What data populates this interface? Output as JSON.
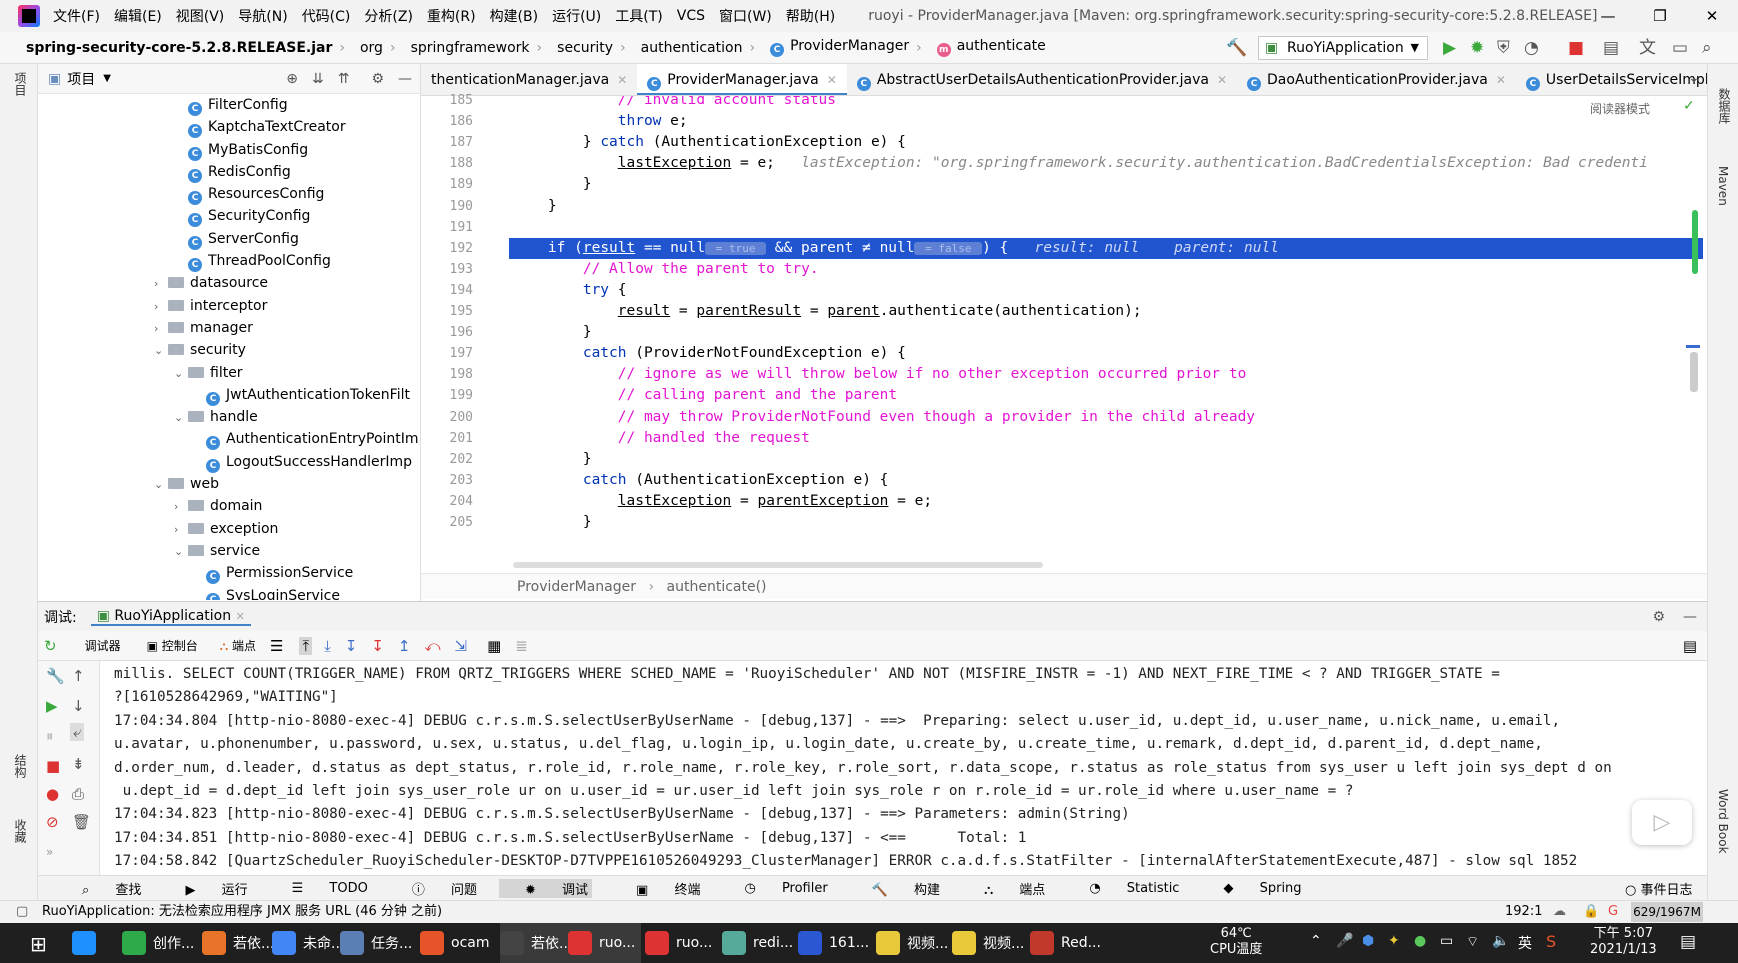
{
  "menu": [
    "文件(F)",
    "编辑(E)",
    "视图(V)",
    "导航(N)",
    "代码(C)",
    "分析(Z)",
    "重构(R)",
    "构建(B)",
    "运行(U)",
    "工具(T)",
    "VCS",
    "窗口(W)",
    "帮助(H)"
  ],
  "window_title": "ruoyi - ProviderManager.java [Maven: org.springframework.security:spring-security-core:5.2.8.RELEASE]",
  "breadcrumb": {
    "jar": "spring-security-core-5.2.8.RELEASE.jar",
    "parts": [
      "org",
      "springframework",
      "security",
      "authentication"
    ],
    "cls": "ProviderManager",
    "method": "authenticate"
  },
  "run_config": "RuoYiApplication",
  "project": {
    "title": "项目",
    "items": [
      {
        "label": "FilterConfig",
        "type": "class",
        "indent": 3
      },
      {
        "label": "KaptchaTextCreator",
        "type": "class",
        "indent": 3
      },
      {
        "label": "MyBatisConfig",
        "type": "class",
        "indent": 3
      },
      {
        "label": "RedisConfig",
        "type": "class",
        "indent": 3
      },
      {
        "label": "ResourcesConfig",
        "type": "class",
        "indent": 3
      },
      {
        "label": "SecurityConfig",
        "type": "class",
        "indent": 3
      },
      {
        "label": "ServerConfig",
        "type": "class",
        "indent": 3
      },
      {
        "label": "ThreadPoolConfig",
        "type": "class",
        "indent": 3
      },
      {
        "label": "datasource",
        "type": "folder",
        "indent": 2,
        "arrow": "›"
      },
      {
        "label": "interceptor",
        "type": "folder",
        "indent": 2,
        "arrow": "›"
      },
      {
        "label": "manager",
        "type": "folder",
        "indent": 2,
        "arrow": "›"
      },
      {
        "label": "security",
        "type": "folder",
        "indent": 2,
        "arrow": "⌄"
      },
      {
        "label": "filter",
        "type": "folder",
        "indent": 3,
        "arrow": "⌄"
      },
      {
        "label": "JwtAuthenticationTokenFilt",
        "type": "class",
        "indent": 4
      },
      {
        "label": "handle",
        "type": "folder",
        "indent": 3,
        "arrow": "⌄"
      },
      {
        "label": "AuthenticationEntryPointIm",
        "type": "class",
        "indent": 4
      },
      {
        "label": "LogoutSuccessHandlerImp",
        "type": "class",
        "indent": 4
      },
      {
        "label": "web",
        "type": "folder",
        "indent": 2,
        "arrow": "⌄"
      },
      {
        "label": "domain",
        "type": "folder",
        "indent": 3,
        "arrow": "›"
      },
      {
        "label": "exception",
        "type": "folder",
        "indent": 3,
        "arrow": "›"
      },
      {
        "label": "service",
        "type": "folder",
        "indent": 3,
        "arrow": "⌄"
      },
      {
        "label": "PermissionService",
        "type": "class",
        "indent": 4
      },
      {
        "label": "SysLoginService",
        "type": "class",
        "indent": 4
      }
    ]
  },
  "tabs": [
    {
      "label": "thenticationManager.java",
      "active": false
    },
    {
      "label": "ProviderManager.java",
      "active": true
    },
    {
      "label": "AbstractUserDetailsAuthenticationProvider.java",
      "active": false
    },
    {
      "label": "DaoAuthenticationProvider.java",
      "active": false
    },
    {
      "label": "UserDetailsServiceImpl.java",
      "active": false
    }
  ],
  "reader_mode": "阅读器模式",
  "code_lines": [
    {
      "n": "185",
      "html": "            <span class='cm'>// invalid account status</span>"
    },
    {
      "n": "186",
      "html": "            <span class='kw'>throw</span> e;"
    },
    {
      "n": "187",
      "html": "        } <span class='kw'>catch</span> (AuthenticationException e) {"
    },
    {
      "n": "188",
      "html": "            <span class='var'>lastException</span> = e;  <span class='hint'> lastException: \"org.springframework.security.authentication.BadCredentialsException: Bad credenti</span>"
    },
    {
      "n": "189",
      "html": "        }"
    },
    {
      "n": "190",
      "html": "    }"
    },
    {
      "n": "191",
      "html": ""
    },
    {
      "n": "192",
      "html": "    <span class='kw'>if</span> (<span class='var'>result</span> == null<span class='pill'> = true </span> &amp;&amp; parent ≠ null<span class='pill'> = false </span>) {  <span class='hint' style='color:#cfd8f5'> result: null    parent: null</span>",
      "hl": true
    },
    {
      "n": "193",
      "html": "        <span class='cm'>// Allow the parent to try.</span>"
    },
    {
      "n": "194",
      "html": "        <span class='kw'>try</span> {"
    },
    {
      "n": "195",
      "html": "            <span class='var'>result</span> = <span class='var'>parentResult</span> = <span class='var'>parent</span>.authenticate(authentication);"
    },
    {
      "n": "196",
      "html": "        }"
    },
    {
      "n": "197",
      "html": "        <span class='kw'>catch</span> (ProviderNotFoundException e) {"
    },
    {
      "n": "198",
      "html": "            <span class='cm'>// ignore as we will throw below if no other exception occurred prior to</span>"
    },
    {
      "n": "199",
      "html": "            <span class='cm'>// calling parent and the parent</span>"
    },
    {
      "n": "200",
      "html": "            <span class='cm'>// may throw ProviderNotFound even though a provider in the child already</span>"
    },
    {
      "n": "201",
      "html": "            <span class='cm'>// handled the request</span>"
    },
    {
      "n": "202",
      "html": "        }"
    },
    {
      "n": "203",
      "html": "        <span class='kw'>catch</span> (AuthenticationException e) {"
    },
    {
      "n": "204",
      "html": "            <span class='var'>lastException</span> = <span class='var'>parentException</span> = e;"
    },
    {
      "n": "205",
      "html": "        }"
    }
  ],
  "code_crumb": {
    "cls": "ProviderManager",
    "method": "authenticate()"
  },
  "debug": {
    "label": "调试:",
    "app": "RuoYiApplication",
    "tools": {
      "debugger": "调试器",
      "console": "控制台",
      "breakpoints": "端点"
    }
  },
  "console_lines": [
    "millis. SELECT COUNT(TRIGGER_NAME) FROM QRTZ_TRIGGERS WHERE SCHED_NAME = 'RuoyiScheduler' AND NOT (MISFIRE_INSTR = -1) AND NEXT_FIRE_TIME < ? AND TRIGGER_STATE =",
    "?[1610528642969,\"WAITING\"]",
    "17:04:34.804 [http-nio-8080-exec-4] DEBUG c.r.s.m.S.selectUserByUserName - [debug,137] - ==>  Preparing: select u.user_id, u.dept_id, u.user_name, u.nick_name, u.email,",
    "u.avatar, u.phonenumber, u.password, u.sex, u.status, u.del_flag, u.login_ip, u.login_date, u.create_by, u.create_time, u.remark, d.dept_id, d.parent_id, d.dept_name,",
    "d.order_num, d.leader, d.status as dept_status, r.role_id, r.role_name, r.role_key, r.role_sort, r.data_scope, r.status as role_status from sys_user u left join sys_dept d on",
    " u.dept_id = d.dept_id left join sys_user_role ur on u.user_id = ur.user_id left join sys_role r on r.role_id = ur.role_id where u.user_name = ?",
    "17:04:34.823 [http-nio-8080-exec-4] DEBUG c.r.s.m.S.selectUserByUserName - [debug,137] - ==> Parameters: admin(String)",
    "17:04:34.851 [http-nio-8080-exec-4] DEBUG c.r.s.m.S.selectUserByUserName - [debug,137] - <==      Total: 1",
    "17:04:58.842 [QuartzScheduler_RuoyiScheduler-DESKTOP-D7TVPPE1610526049293_ClusterManager] ERROR c.a.d.f.s.StatFilter - [internalAfterStatementExecute,487] - slow sql 1852"
  ],
  "bottom_tools": [
    "查找",
    "运行",
    "TODO",
    "问题",
    "调试",
    "终端",
    "Profiler",
    "构建",
    "端点",
    "Statistic",
    "Spring"
  ],
  "event_log": "事件日志",
  "status": {
    "message": "RuoYiApplication: 无法检索应用程序 JMX 服务 URL (46 分钟 之前)",
    "position": "192:1",
    "memory": "629/1967M"
  },
  "side_labels": {
    "left_top": "项目",
    "left_mid": "结构",
    "left_bot": "收藏",
    "right_top": "数据库",
    "right_mid": "Maven",
    "right_bot": "Word Book"
  },
  "taskbar": {
    "items": [
      "创作...",
      "若依...",
      "未命...",
      "任务...",
      "ocam",
      "若依...",
      "ruo...",
      "ruo...",
      "redi...",
      "161...",
      "视频...",
      "视频...",
      "Red..."
    ],
    "temp": "64℃",
    "temp_label": "CPU温度",
    "ime": "英",
    "time": "下午 5:07",
    "date": "2021/1/13"
  }
}
